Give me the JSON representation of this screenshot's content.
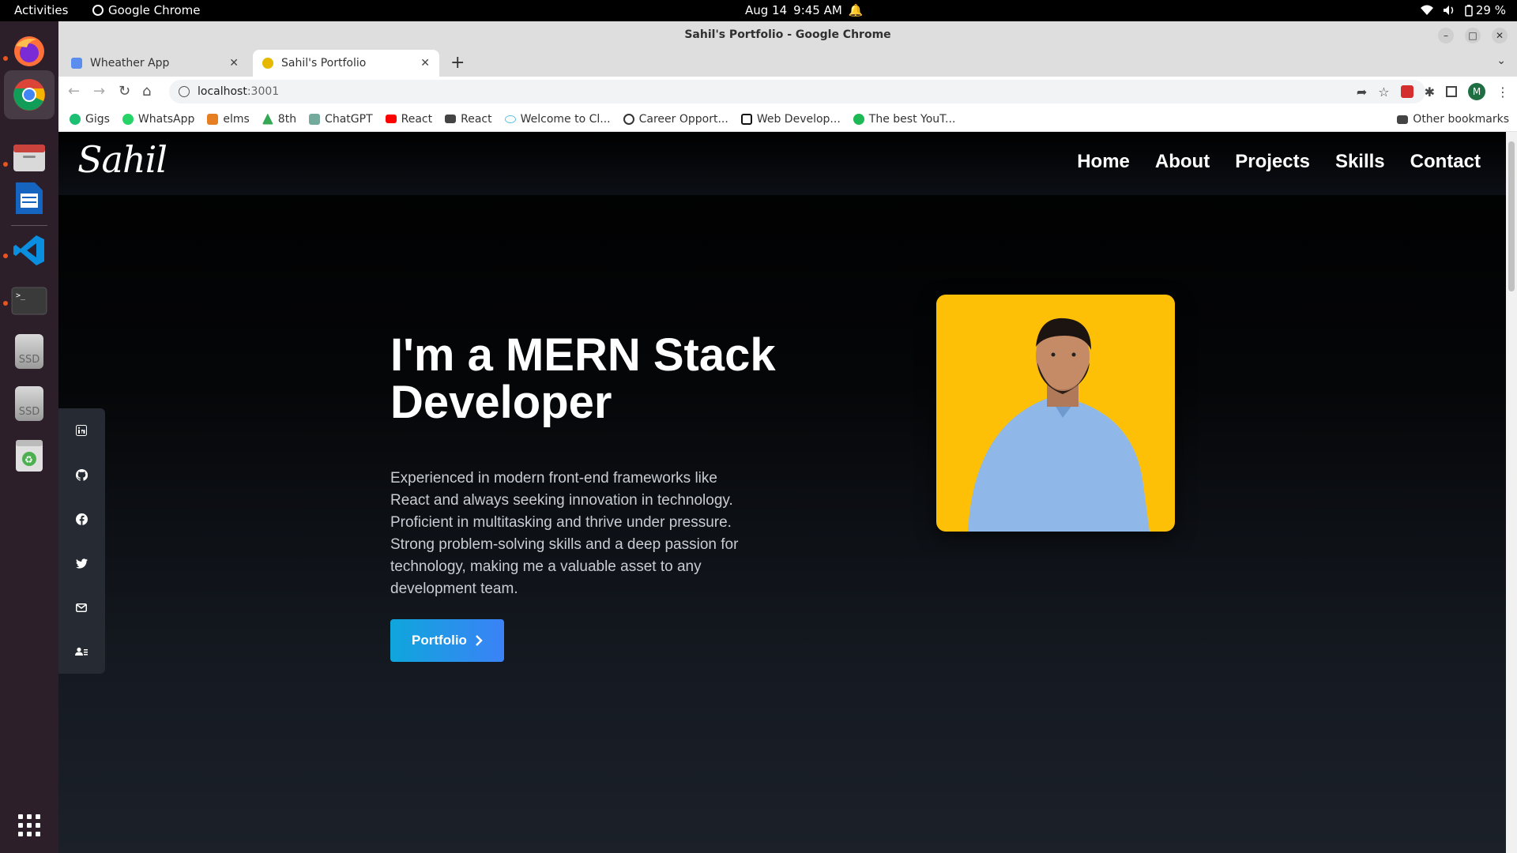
{
  "system_bar": {
    "activities": "Activities",
    "app_name": "Google Chrome",
    "date": "Aug 14",
    "time": "9:45 AM",
    "battery": "29 %"
  },
  "dock": {
    "apps": [
      "firefox-icon",
      "chrome-icon",
      "files-icon",
      "writer-icon",
      "vscode-icon",
      "terminal-icon",
      "ssd-drive-icon",
      "ssd-drive-icon",
      "trash-icon"
    ],
    "ssd_label": "SSD"
  },
  "window": {
    "title": "Sahil's Portfolio - Google Chrome"
  },
  "tabs": [
    {
      "label": "Wheather App",
      "active": false
    },
    {
      "label": "Sahil's Portfolio",
      "active": true
    }
  ],
  "address_bar": {
    "host": "localhost",
    "port": ":3001"
  },
  "profile_initial": "M",
  "bookmarks": [
    {
      "label": "Gigs",
      "color": "#1dbf73"
    },
    {
      "label": "WhatsApp",
      "color": "#25d366"
    },
    {
      "label": "elms",
      "color": "#e67e22"
    },
    {
      "label": "8th",
      "color": "#34a853"
    },
    {
      "label": "ChatGPT",
      "color": "#74aa9c"
    },
    {
      "label": "React",
      "color": "#ff0000"
    },
    {
      "label": "React",
      "color": "#444444"
    },
    {
      "label": "Welcome to Cl...",
      "color": "#5bc0eb"
    },
    {
      "label": "Career Opport...",
      "color": "#333333"
    },
    {
      "label": "Web Develop...",
      "color": "#111111"
    },
    {
      "label": "The best YouT...",
      "color": "#1db954"
    }
  ],
  "other_bookmarks": "Other bookmarks",
  "site": {
    "logo": "Sahil",
    "nav": [
      "Home",
      "About",
      "Projects",
      "Skills",
      "Contact"
    ],
    "social_icons": [
      "linkedin-icon",
      "github-icon",
      "facebook-icon",
      "twitter-icon",
      "mail-icon",
      "contact-card-icon"
    ],
    "hero_title": "I'm a MERN Stack Developer",
    "hero_description": "Experienced in modern front-end frameworks like React and always seeking innovation in technology. Proficient in multitasking and thrive under pressure. Strong problem-solving skills and a deep passion for technology, making me a valuable asset to any development team.",
    "cta_label": "Portfolio",
    "photo_bg": "#fec006"
  },
  "colors": {
    "cta_start": "#0fa6dc",
    "cta_end": "#3b82f6",
    "dock_bg": "#2c1f2a"
  }
}
